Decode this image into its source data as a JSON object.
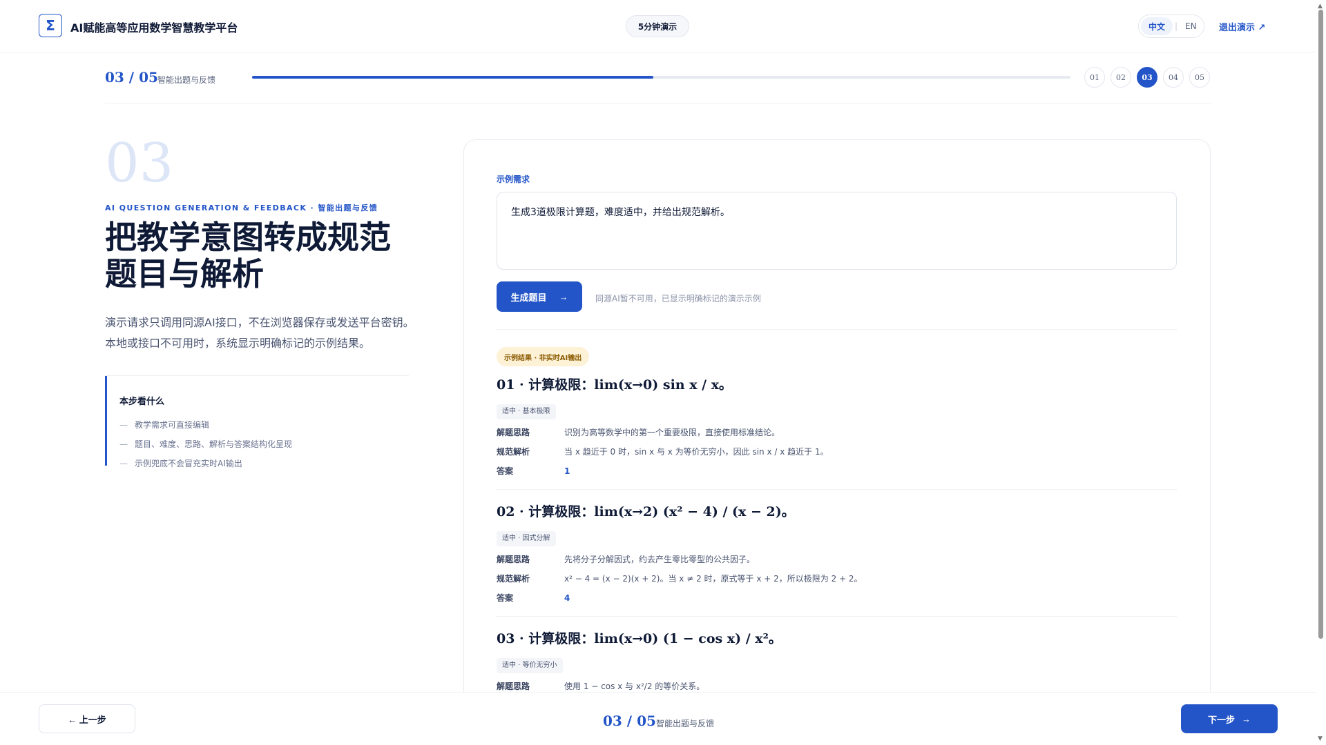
{
  "header": {
    "logo_symbol": "Σ",
    "app_title": "AI赋能高等应用数学智慧教学平台",
    "demo_pill": "5分钟演示",
    "lang_zh": "中文",
    "lang_sep": "|",
    "lang_en": "EN",
    "exit_label": "退出演示 ↗"
  },
  "progress": {
    "counter": "03 / 05",
    "step_name": "智能出题与反馈",
    "fill_fraction": 0.49,
    "dots": [
      "01",
      "02",
      "03",
      "04",
      "05"
    ],
    "active_index": 2
  },
  "left": {
    "big_number": "03",
    "kicker": "AI QUESTION GENERATION & FEEDBACK · 智能出题与反馈",
    "headline": "把教学意图转成规范题目与解析",
    "intro": "演示请求只调用同源AI接口，不在浏览器保存或发送平台密钥。本地或接口不可用时，系统显示明确标记的示例结果。",
    "steps_title": "本步看什么",
    "steps": [
      "教学需求可直接编辑",
      "题目、难度、思路、解析与答案结构化呈现",
      "示例兜底不会冒充实时AI输出"
    ],
    "dash": "—"
  },
  "card": {
    "req_label": "示例需求",
    "req_value": "生成3道极限计算题，难度适中，并给出规范解析。",
    "gen_button": "生成题目",
    "gen_arrow": "→",
    "gen_note": "同源AI暂不可用，已显示明确标记的演示示例",
    "result_badge": "示例结果 · 非实时AI输出",
    "labels": {
      "idea": "解题思路",
      "solution": "规范解析",
      "answer": "答案"
    },
    "problems": [
      {
        "title": "01 · 计算极限：lim(x→0) sin x / x。",
        "tag": "适中 · 基本极限",
        "idea": "识别为高等数学中的第一个重要极限，直接使用标准结论。",
        "solution": "当 x 趋近于 0 时，sin x 与 x 为等价无穷小，因此 sin x / x 趋近于 1。",
        "answer": "1"
      },
      {
        "title": "02 · 计算极限：lim(x→2) (x² − 4) / (x − 2)。",
        "tag": "适中 · 因式分解",
        "idea": "先将分子分解因式，约去产生零比零型的公共因子。",
        "solution": "x² − 4 = (x − 2)(x + 2)。当 x ≠ 2 时，原式等于 x + 2，所以极限为 2 + 2。",
        "answer": "4"
      },
      {
        "title": "03 · 计算极限：lim(x→0) (1 − cos x) / x²。",
        "tag": "适中 · 等价无穷小",
        "idea": "使用 1 − cos x 与 x²/2 的等价关系。",
        "solution": "",
        "answer": ""
      }
    ]
  },
  "footer": {
    "prev_label": "← 上一步",
    "counter": "03 / 05",
    "step_name": "智能出题与反馈",
    "next_label": "下一步",
    "next_arrow": "→"
  },
  "colors": {
    "accent": "#2355c8",
    "badge_bg": "#fdf1d6",
    "badge_text": "#8a5a00"
  }
}
